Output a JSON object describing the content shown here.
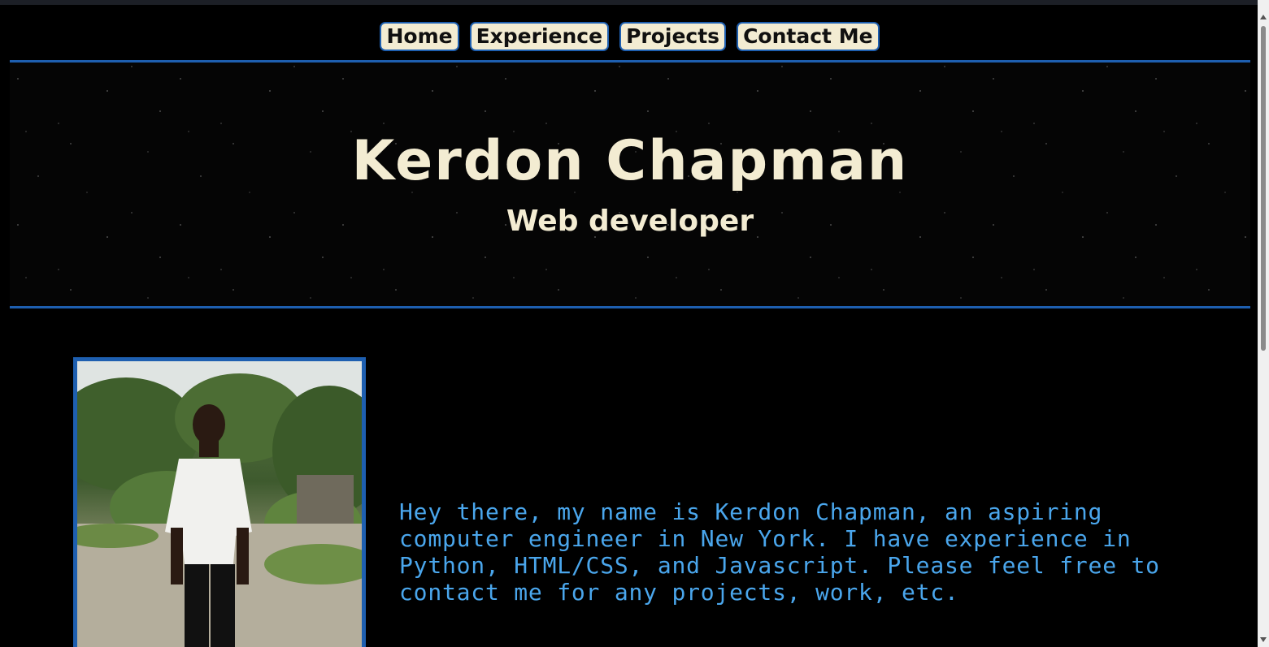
{
  "nav": {
    "items": [
      {
        "label": "Home"
      },
      {
        "label": "Experience"
      },
      {
        "label": "Projects"
      },
      {
        "label": "Contact Me"
      }
    ]
  },
  "hero": {
    "name": "Kerdon Chapman",
    "role": "Web developer"
  },
  "about": {
    "text": "Hey there, my name is Kerdon Chapman, an aspiring computer engineer in New York. I have experience in Python, HTML/CSS, and Javascript. Please feel free to contact me for any projects, work, etc."
  },
  "colors": {
    "background": "#000000",
    "accent_blue": "#1e5fb0",
    "cream": "#f3ecd2",
    "text_blue": "#4aa6ec"
  }
}
